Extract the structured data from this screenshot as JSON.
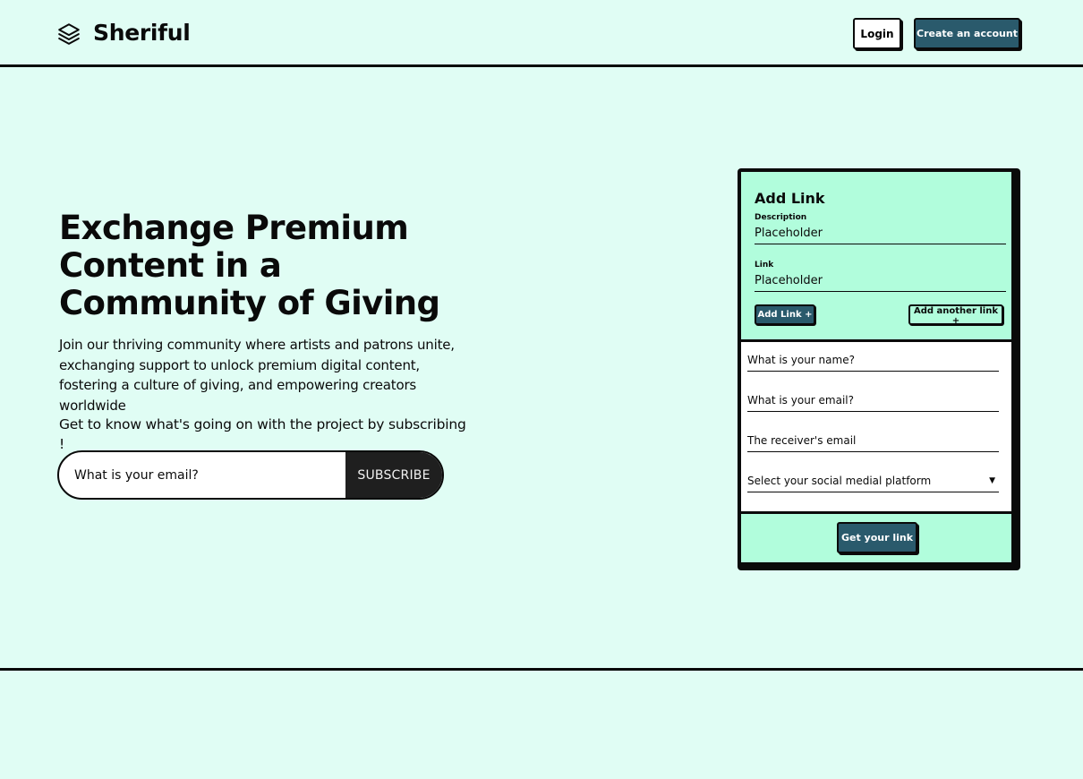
{
  "header": {
    "brand": "Sheriful",
    "logo_icon": "layers-icon",
    "login_label": "Login",
    "create_account_label": "Create an account"
  },
  "hero": {
    "title": "Exchange Premium Content in a Community of Giving",
    "description": "Join our thriving community where artists and patrons unite, exchanging support to unlock premium digital content, fostering a culture of giving, and empowering creators worldwide",
    "subscribe_prompt": "Get to know what's going on with the project by subscribing !",
    "email_placeholder": "What is your email?",
    "subscribe_label": "SUBSCRIBE"
  },
  "card": {
    "title": "Add Link",
    "description_label": "Description",
    "description_placeholder": "Placeholder",
    "link_label": "Link",
    "link_placeholder": "Placeholder",
    "add_link_label": "Add Link +",
    "add_another_label": "Add another link +",
    "name_placeholder": "What is your name?",
    "email_placeholder": "What is your email?",
    "receiver_placeholder": "The receiver's email",
    "platform_select": "Select your social medial platform",
    "get_link_label": "Get your link"
  },
  "colors": {
    "background": "#e0fdf4",
    "card_accent": "#b1fddc",
    "primary_button": "#2a5a6c",
    "border": "#0a0a0a"
  }
}
